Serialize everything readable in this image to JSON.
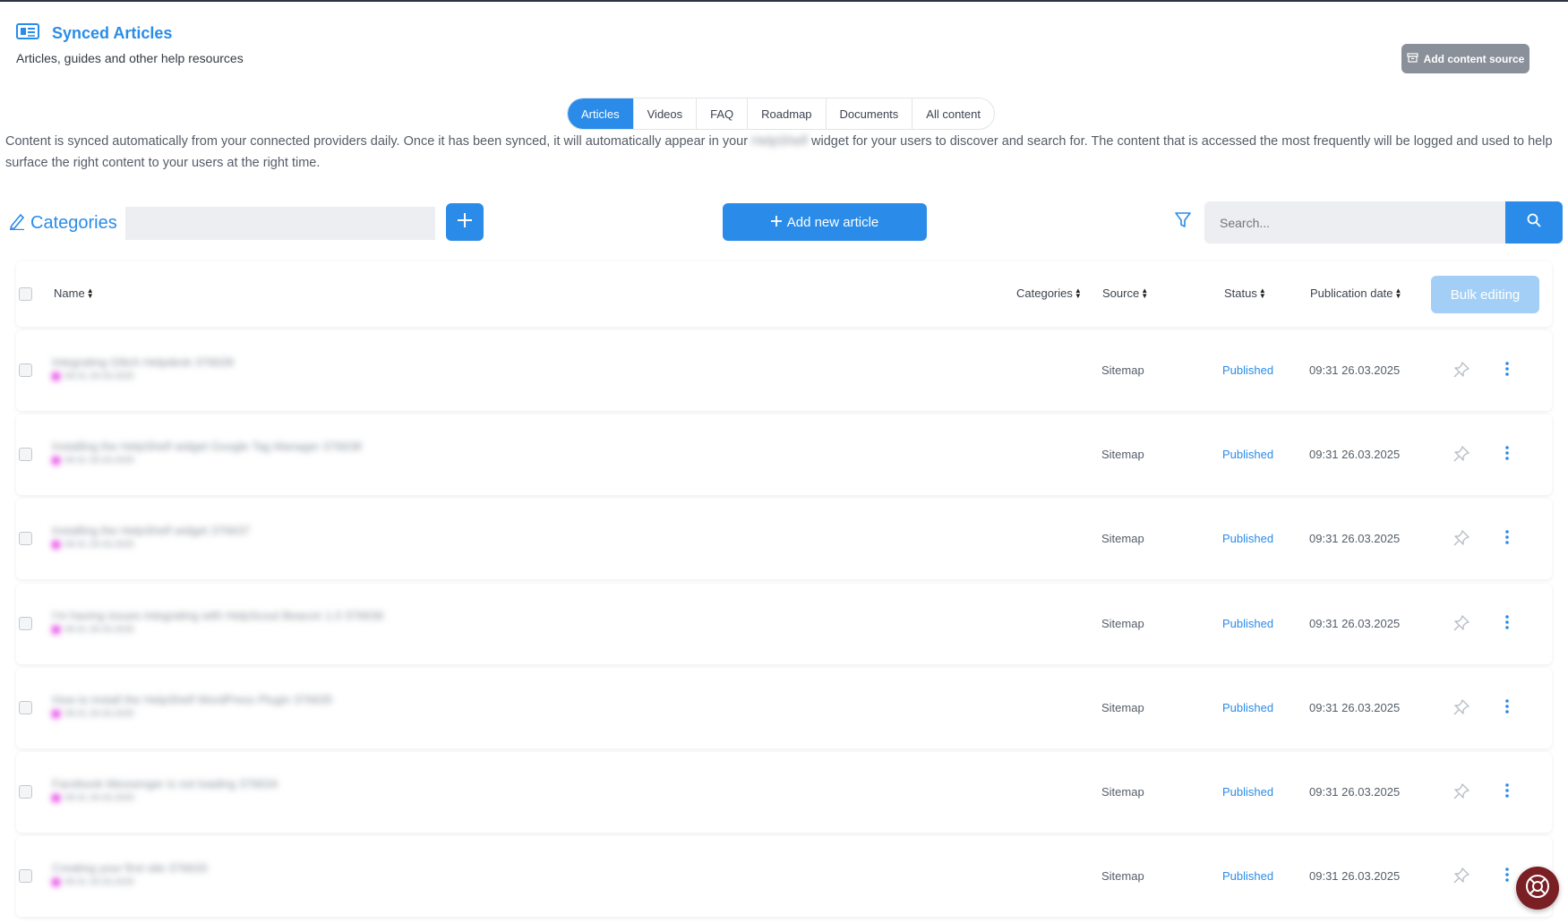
{
  "header": {
    "title": "Synced Articles",
    "subtitle": "Articles, guides and other help resources",
    "add_source_label": "Add content source"
  },
  "tabs": [
    "Articles",
    "Videos",
    "FAQ",
    "Roadmap",
    "Documents",
    "All content"
  ],
  "active_tab": "Articles",
  "description": {
    "part1": "Content is synced automatically from your connected providers daily. Once it has been synced, it will automatically appear in your",
    "redacted_brand": "HelpShelf",
    "part2": "widget for your users to discover and search for. The content that is accessed the most frequently will be logged and used to help surface the right content to your users at the right time."
  },
  "toolbar": {
    "categories_label": "Categories",
    "add_article_label": "Add new article",
    "search_placeholder": "Search..."
  },
  "table": {
    "columns": {
      "name": "Name",
      "categories": "Categories",
      "source": "Source",
      "status": "Status",
      "publication_date": "Publication date"
    },
    "bulk_editing_label": "Bulk editing",
    "rows": [
      {
        "name": "Integrating Glitch Helpdesk 376639",
        "meta": "09:31 26.03.2025",
        "source": "Sitemap",
        "status": "Published",
        "date": "09:31 26.03.2025"
      },
      {
        "name": "Installing the HelpShelf widget Google Tag Manager 376638",
        "meta": "09:31 26.03.2025",
        "source": "Sitemap",
        "status": "Published",
        "date": "09:31 26.03.2025"
      },
      {
        "name": "Installing the HelpShelf widget 376637",
        "meta": "09:31 26.03.2025",
        "source": "Sitemap",
        "status": "Published",
        "date": "09:31 26.03.2025"
      },
      {
        "name": "I'm having issues integrating with HelpScout Beacon 1.0 376636",
        "meta": "09:31 26.03.2025",
        "source": "Sitemap",
        "status": "Published",
        "date": "09:31 26.03.2025"
      },
      {
        "name": "How to install the HelpShelf WordPress Plugin 376635",
        "meta": "09:31 26.03.2025",
        "source": "Sitemap",
        "status": "Published",
        "date": "09:31 26.03.2025"
      },
      {
        "name": "Facebook Messenger is not loading 376634",
        "meta": "09:31 26.03.2025",
        "source": "Sitemap",
        "status": "Published",
        "date": "09:31 26.03.2025"
      },
      {
        "name": "Creating your first site 376633",
        "meta": "09:31 26.03.2025",
        "source": "Sitemap",
        "status": "Published",
        "date": "09:31 26.03.2025"
      }
    ]
  },
  "colors": {
    "accent": "#2a8ce8",
    "tag": "#e64fe6",
    "help_fab": "#7a1f24"
  }
}
